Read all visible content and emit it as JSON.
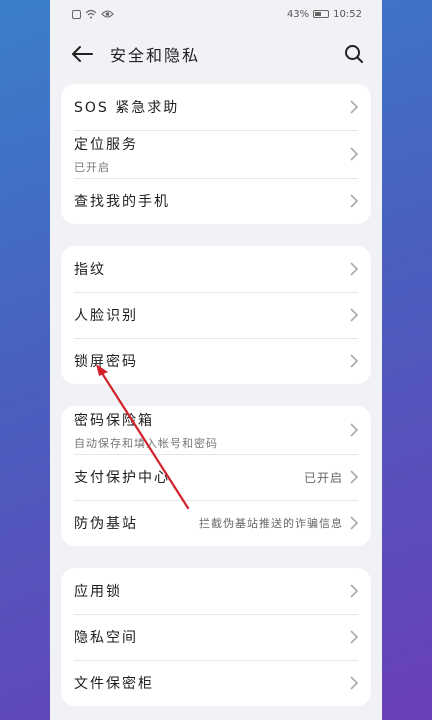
{
  "status": {
    "battery": "43%",
    "time": "10:52"
  },
  "header": {
    "title": "安全和隐私"
  },
  "groups": [
    {
      "items": [
        {
          "label": "SOS 紧急求助",
          "sub": "",
          "value": ""
        },
        {
          "label": "定位服务",
          "sub": "已开启",
          "value": ""
        },
        {
          "label": "查找我的手机",
          "sub": "",
          "value": ""
        }
      ]
    },
    {
      "items": [
        {
          "label": "指纹",
          "sub": "",
          "value": ""
        },
        {
          "label": "人脸识别",
          "sub": "",
          "value": ""
        },
        {
          "label": "锁屏密码",
          "sub": "",
          "value": ""
        }
      ]
    },
    {
      "items": [
        {
          "label": "密码保险箱",
          "sub": "自动保存和填入帐号和密码",
          "value": ""
        },
        {
          "label": "支付保护中心",
          "sub": "",
          "value": "已开启"
        },
        {
          "label": "防伪基站",
          "sub": "",
          "value": "拦截伪基站推送的诈骗信息"
        }
      ]
    },
    {
      "items": [
        {
          "label": "应用锁",
          "sub": "",
          "value": ""
        },
        {
          "label": "隐私空间",
          "sub": "",
          "value": ""
        },
        {
          "label": "文件保密柜",
          "sub": "",
          "value": ""
        }
      ]
    }
  ],
  "colors": {
    "annotation_arrow": "#d2222a"
  }
}
